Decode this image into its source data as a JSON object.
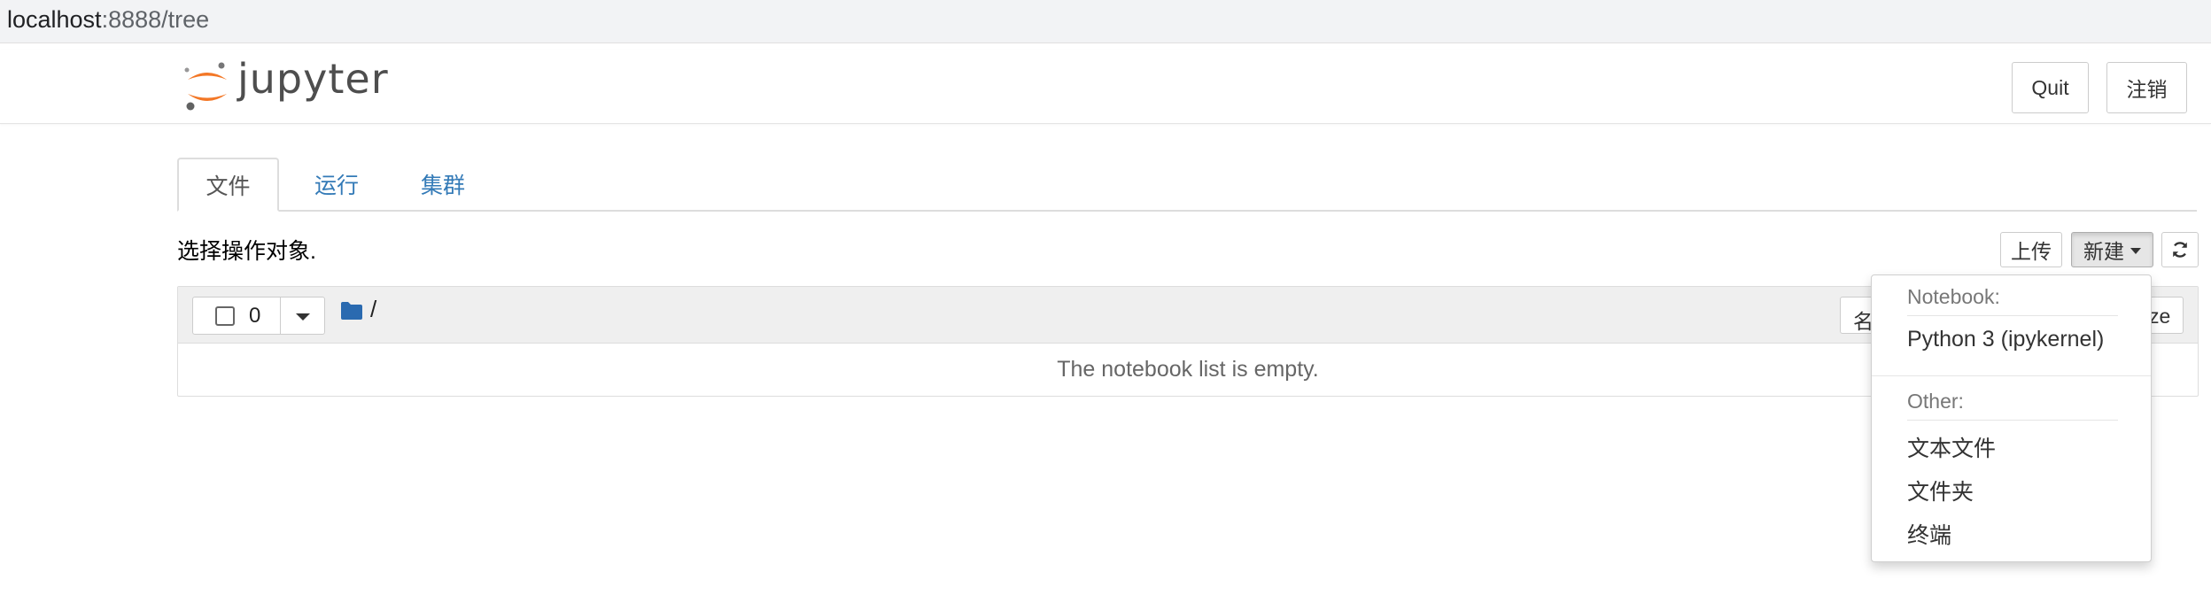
{
  "browser": {
    "url_host": "localhost",
    "url_path": ":8888/tree"
  },
  "header": {
    "logo_text": "jupyter",
    "quit_label": "Quit",
    "logout_label": "注销"
  },
  "tabs": [
    {
      "label": "文件",
      "active": true
    },
    {
      "label": "运行",
      "active": false
    },
    {
      "label": "集群",
      "active": false
    }
  ],
  "toolbar": {
    "select_text": "选择操作对象.",
    "upload_label": "上传",
    "new_label": "新建",
    "refresh_icon": "refresh-icon"
  },
  "file_list": {
    "selected_count": "0",
    "breadcrumb": "/",
    "sort_name_label": "名",
    "sort_size_label": "ze",
    "empty_message": "The notebook list is empty."
  },
  "new_menu": {
    "notebook_header": "Notebook:",
    "notebook_items": [
      "Python 3 (ipykernel)"
    ],
    "other_header": "Other:",
    "other_items": [
      "文本文件",
      "文件夹",
      "终端"
    ]
  },
  "colors": {
    "link": "#337ab7",
    "logo_orange": "#f37726",
    "folder_blue": "#2a6ab0"
  }
}
